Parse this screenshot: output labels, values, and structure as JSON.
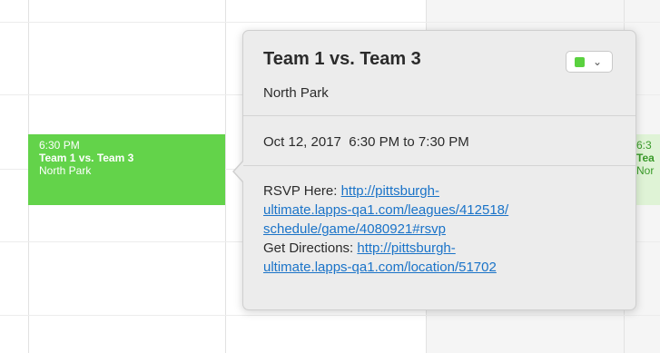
{
  "calendar": {
    "event": {
      "time": "6:30 PM",
      "title": "Team 1 vs. Team 3",
      "location": "North Park",
      "color": "#63d34a"
    },
    "next_event_peek": {
      "time": "6:3",
      "title": "Tea",
      "location": "Nor"
    }
  },
  "popover": {
    "title": "Team 1 vs. Team 3",
    "location": "North Park",
    "color_picker": {
      "selected_color": "#5ad13f",
      "chevron": "chevron-down-icon"
    },
    "datetime": "Oct 12, 2017  6:30 PM to 7:30 PM",
    "notes": {
      "rsvp_label": "RSVP Here: ",
      "rsvp_link_lines": [
        "http://pittsburgh-",
        "ultimate.lapps-qa1.com/leagues/412518/",
        "schedule/game/4080921#rsvp"
      ],
      "directions_label": "Get Directions: ",
      "directions_link_lines": [
        "http://pittsburgh-",
        "ultimate.lapps-qa1.com/location/51702"
      ]
    }
  }
}
